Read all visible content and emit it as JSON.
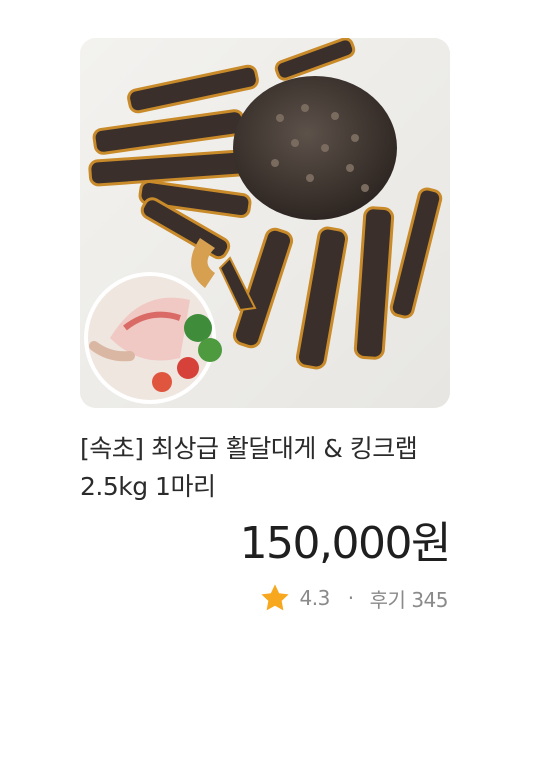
{
  "product": {
    "image_alt": "crab-photo",
    "title": "[속초]  최상급 활달대게 & 킹크랩 2.5kg 1마리",
    "price": "150,000원",
    "rating": "4.3",
    "separator": "·",
    "review_count": "후기 345",
    "star_icon": "star-icon",
    "star_color": "#f7a81e"
  }
}
